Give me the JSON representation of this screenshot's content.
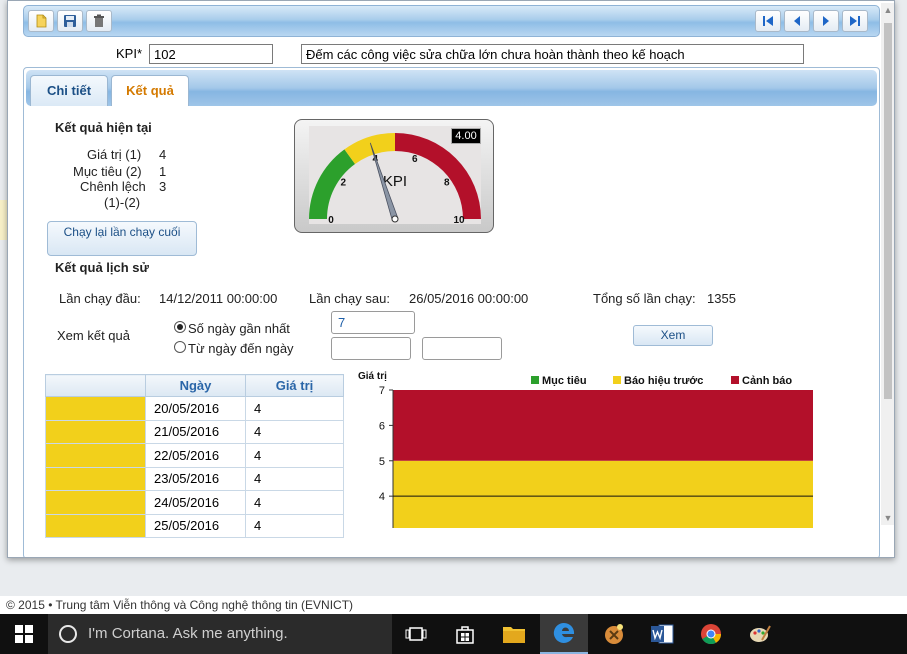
{
  "footer": {
    "text": "©  2015  •  Trung tâm Viễn thông và Công nghệ thông tin (EVNICT)"
  },
  "toolbar": {
    "new_icon": "new-document-icon",
    "save_icon": "save-icon",
    "delete_icon": "trash-icon",
    "first_icon": "first-record-icon",
    "prev_icon": "previous-record-icon",
    "next_icon": "next-record-icon",
    "last_icon": "last-record-icon"
  },
  "kpi": {
    "label": "KPI*",
    "code": "102",
    "description": "Đếm các công việc sửa chữa lớn chưa hoàn thành theo kế hoạch"
  },
  "tabs": [
    {
      "label": "Chi tiết",
      "active": false
    },
    {
      "label": "Kết quả",
      "active": true
    }
  ],
  "current": {
    "title": "Kết quả hiện tại",
    "value_label": "Giá trị (1)",
    "value": "4",
    "target_label": "Mục tiêu (2)",
    "target": "1",
    "diff_label": "Chênh lệch",
    "diff_label2": "(1)-(2)",
    "diff": "3",
    "rerun_button": "Chạy lại lần chạy cuối"
  },
  "gauge": {
    "title": "KPI",
    "value_display": "4.00",
    "value": 4,
    "min": 0,
    "max": 10,
    "ticks": [
      "0",
      "2",
      "4",
      "6",
      "8",
      "10"
    ],
    "bands": [
      {
        "from": 0,
        "to": 3,
        "color": "#2ca02c"
      },
      {
        "from": 3,
        "to": 5,
        "color": "#f2d01b"
      },
      {
        "from": 5,
        "to": 10,
        "color": "#b3102a"
      }
    ]
  },
  "history": {
    "title": "Kết quả lịch sử",
    "first_run_label": "Lần chạy đầu:",
    "first_run": "14/12/2011 00:00:00",
    "next_run_label": "Lần chạy sau:",
    "next_run": "26/05/2016 00:00:00",
    "total_runs_label": "Tổng số lần chạy:",
    "total_runs": "1355",
    "view_label": "Xem kết quả",
    "option_recent": "Số ngày gần nhất",
    "option_range": "Từ ngày đến ngày",
    "recent_days": "7",
    "from_date": "",
    "to_date": "",
    "view_button": "Xem",
    "columns": [
      "",
      "Ngày",
      "Giá trị"
    ],
    "rows": [
      {
        "date": "20/05/2016",
        "value": "4"
      },
      {
        "date": "21/05/2016",
        "value": "4"
      },
      {
        "date": "22/05/2016",
        "value": "4"
      },
      {
        "date": "23/05/2016",
        "value": "4"
      },
      {
        "date": "24/05/2016",
        "value": "4"
      },
      {
        "date": "25/05/2016",
        "value": "4"
      }
    ],
    "row_color": "#f2d01b"
  },
  "chart_data": {
    "type": "area",
    "ylabel": "Giá trị",
    "ylim": [
      4,
      7
    ],
    "visible_ylim": [
      3.1,
      7
    ],
    "yticks": [
      "7",
      "6",
      "5",
      "4"
    ],
    "legend": [
      {
        "name": "Mục tiêu",
        "color": "#2ca02c"
      },
      {
        "name": "Báo hiệu trước",
        "color": "#f2d01b"
      },
      {
        "name": "Cảnh báo",
        "color": "#b3102a"
      }
    ],
    "bands": [
      {
        "name": "Báo hiệu trước",
        "from": 3.1,
        "to": 5,
        "color": "#f2d01b"
      },
      {
        "name": "Cảnh báo",
        "from": 5,
        "to": 7,
        "color": "#b3102a"
      }
    ],
    "series": [
      {
        "name": "Giá trị",
        "values": [
          4,
          4,
          4,
          4,
          4,
          4
        ]
      }
    ],
    "legend_position": "top-right",
    "grid": false
  },
  "taskbar": {
    "search_placeholder": "I'm Cortana. Ask me anything.",
    "icons": [
      "windows-start-icon",
      "task-view-icon",
      "store-icon",
      "file-explorer-icon",
      "edge-icon",
      "app-icon",
      "word-icon",
      "chrome-icon",
      "paint-icon"
    ]
  }
}
